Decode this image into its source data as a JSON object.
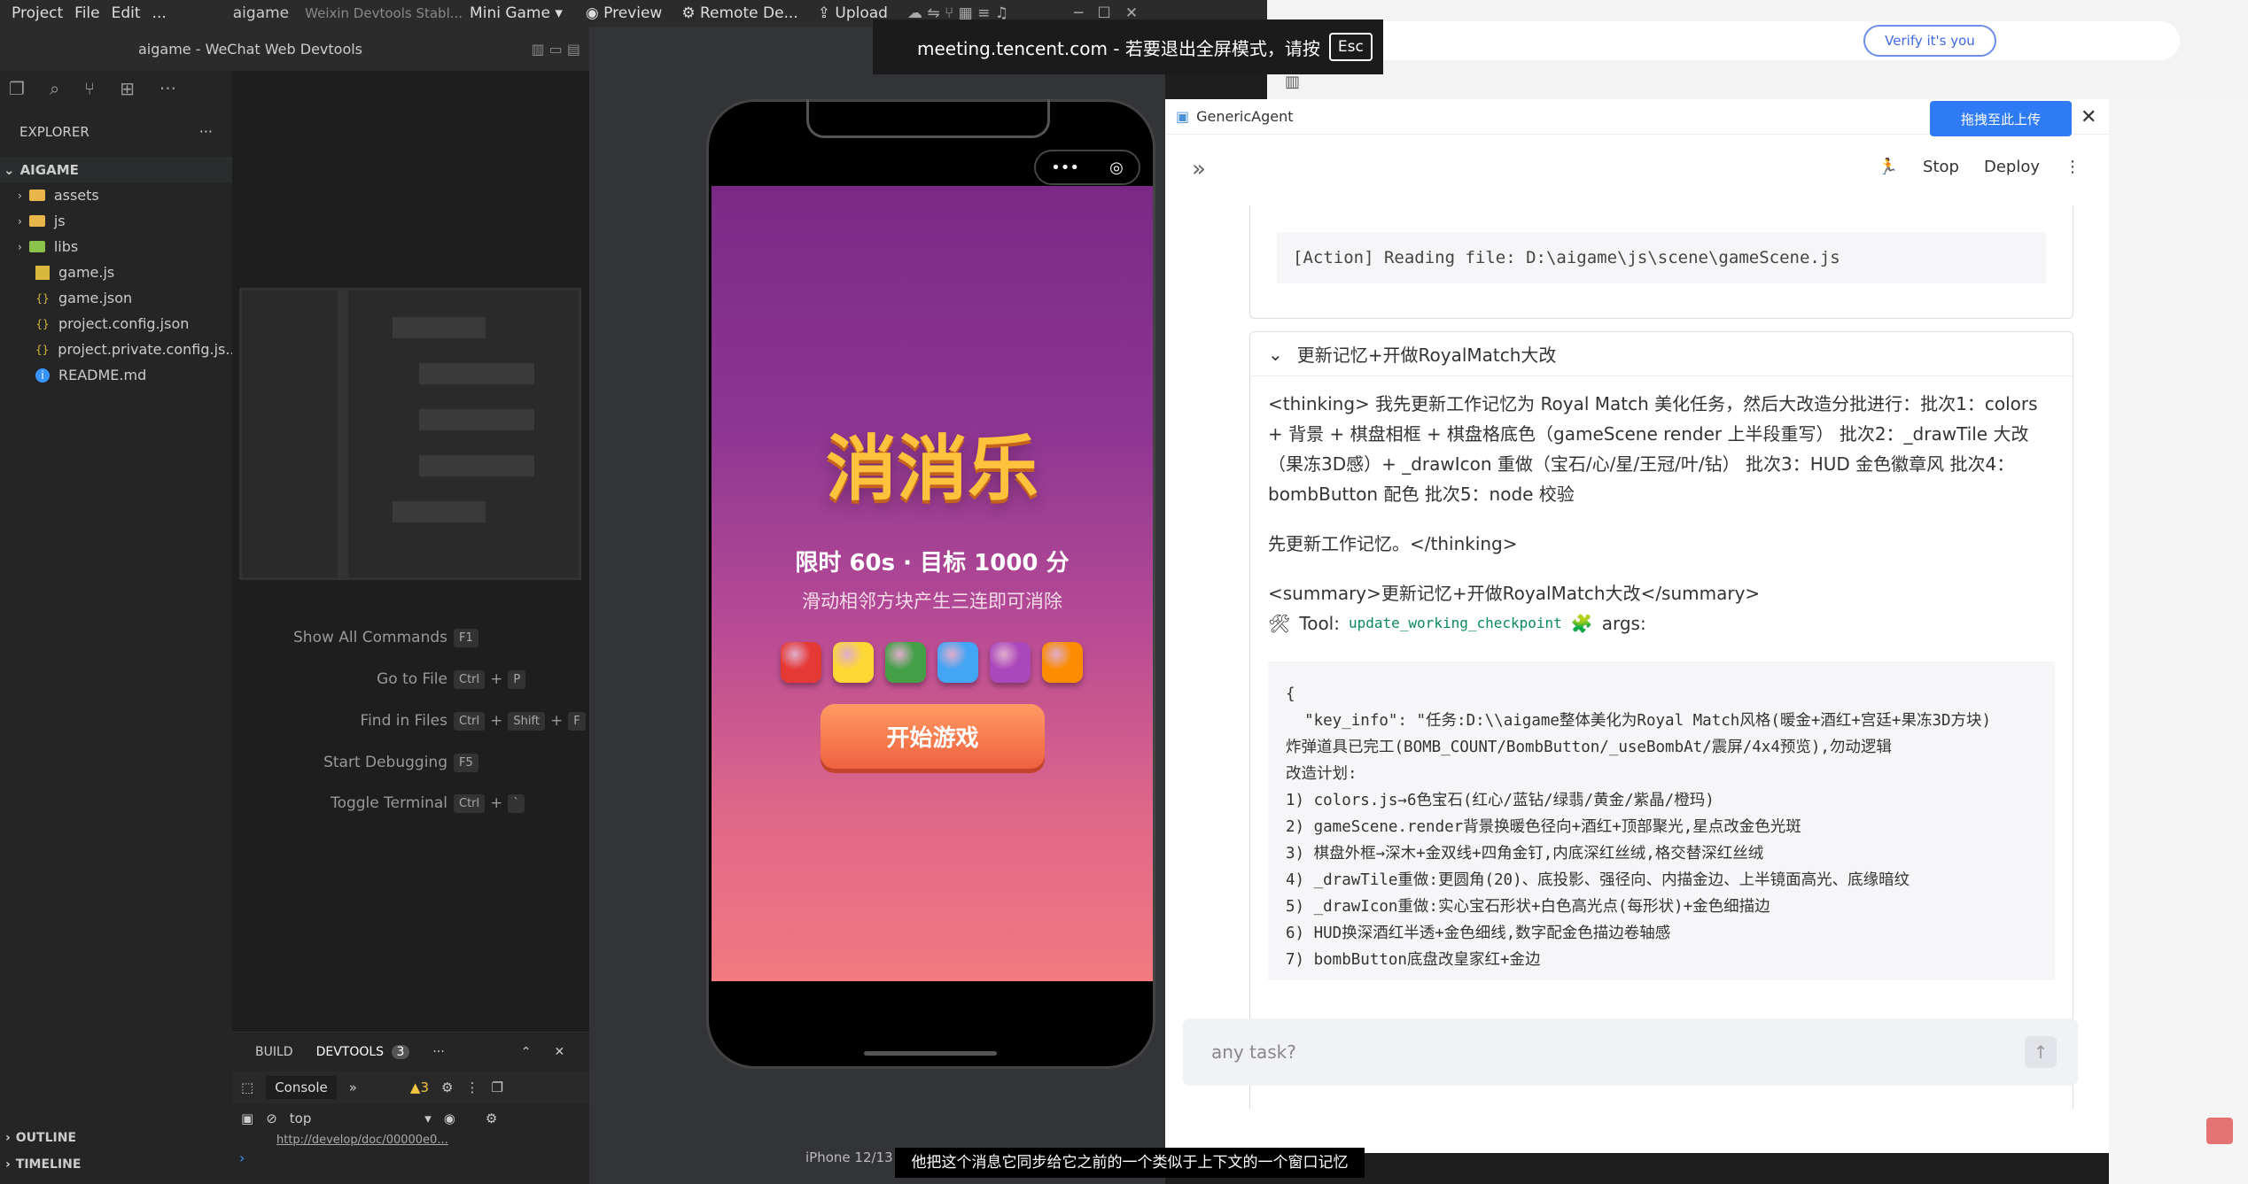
{
  "menubar": {
    "items": [
      "Project",
      "File",
      "Edit",
      "..."
    ],
    "title": "aigame",
    "subtitle": "Weixin Devtools Stabl...",
    "mode": "Mini Game ▾",
    "preview": "Preview",
    "remote": "Remote De...",
    "upload": "Upload"
  },
  "window_title": "aigame - WeChat Web Devtools",
  "explorer": {
    "header": "EXPLORER",
    "root": "AIGAME",
    "items": [
      {
        "name": "assets",
        "type": "folder"
      },
      {
        "name": "js",
        "type": "folder"
      },
      {
        "name": "libs",
        "type": "folder-green"
      },
      {
        "name": "game.js",
        "type": "js"
      },
      {
        "name": "game.json",
        "type": "json"
      },
      {
        "name": "project.config.json",
        "type": "json"
      },
      {
        "name": "project.private.config.js...",
        "type": "json"
      },
      {
        "name": "README.md",
        "type": "info"
      }
    ],
    "outline": "OUTLINE",
    "timeline": "TIMELINE"
  },
  "commands": [
    {
      "label": "Show All Commands",
      "keys": [
        "F1"
      ]
    },
    {
      "label": "Go to File",
      "keys": [
        "Ctrl",
        "P"
      ]
    },
    {
      "label": "Find in Files",
      "keys": [
        "Ctrl",
        "Shift",
        "F"
      ]
    },
    {
      "label": "Start Debugging",
      "keys": [
        "F5"
      ]
    },
    {
      "label": "Toggle Terminal",
      "keys": [
        "Ctrl",
        "`"
      ]
    }
  ],
  "panel": {
    "tab_build": "BUILD",
    "tab_devtools": "DEVTOOLS",
    "devtools_count": "3",
    "console": "Console",
    "warnings": "3",
    "context": "top",
    "url": "http://develop/doc/00000e0..."
  },
  "meeting": {
    "text": "meeting.tencent.com - 若要退出全屏模式，请按",
    "key": "Esc"
  },
  "browser": {
    "verify": "Verify it's you",
    "upload_badge": "拖拽至此上传"
  },
  "game": {
    "title": "消消乐",
    "subtitle": "限时 60s · 目标 1000 分",
    "hint": "滑动相邻方块产生三连即可消除",
    "start": "开始游戏",
    "device": "iPhone 12/13 (..."
  },
  "gem_colors": [
    "#e53935",
    "#fdd835",
    "#43a047",
    "#42a5f5",
    "#ab47bc",
    "#fb8c00"
  ],
  "agent": {
    "app": "GenericAgent",
    "stop": "Stop",
    "deploy": "Deploy",
    "action_line": "[Action] Reading file: D:\\aigame\\js\\scene\\gameScene.js",
    "section_title": "更新记忆+开做RoyalMatch大改",
    "thinking": "<thinking> 我先更新工作记忆为 Royal Match 美化任务，然后大改造分批进行：批次1：colors + 背景 + 棋盘相框 + 棋盘格底色（gameScene render 上半段重写） 批次2：_drawTile 大改（果冻3D感）+ _drawIcon 重做（宝石/心/星/王冠/叶/钻） 批次3：HUD 金色徽章风 批次4：bombButton 配色 批次5：node 校验",
    "thinking2": "先更新工作记忆。</thinking>",
    "summary": "<summary>更新记忆+开做RoyalMatch大改</summary>",
    "tool_label": "Tool:",
    "tool_name": "update_working_checkpoint",
    "args": "args:",
    "code_lines": [
      "{",
      "  \"key_info\": \"任务:D:\\\\aigame整体美化为Royal Match风格(暖金+酒红+宫廷+果冻3D方块)",
      "炸弹道具已完工(BOMB_COUNT/BombButton/_useBombAt/震屏/4x4预览),勿动逻辑",
      "改造计划:",
      "1) colors.js→6色宝石(红心/蓝钻/绿翡/黄金/紫晶/橙玛)",
      "2) gameScene.render背景换暖色径向+酒红+顶部聚光,星点改金色光斑",
      "3) 棋盘外框→深木+金双线+四角金钉,内底深红丝绒,格交替深红丝绒",
      "4) _drawTile重做:更圆角(20)、底投影、强径向、内描金边、上半镜面高光、底缘暗纹",
      "5) _drawIcon重做:实心宝石形状+白色高光点(每形状)+金色细描边",
      "6) HUD换深酒红半透+金色细线,数字配金色描边卷轴感",
      "7) bombButton底盘改皇家红+金边"
    ],
    "input_placeholder": "any task?"
  },
  "caption": "他把这个消息它同步给它之前的一个类似于上下文的一个窗口记忆"
}
